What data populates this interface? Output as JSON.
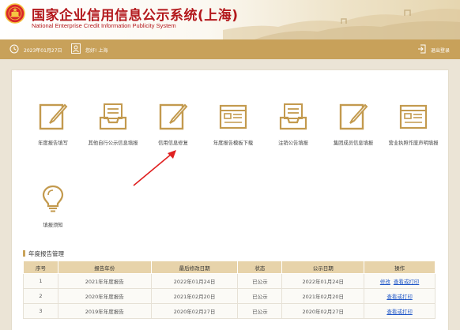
{
  "header": {
    "title": "国家企业信用信息公示系统(上海)",
    "subtitle": "National Enterprise Credit Information Publicity System"
  },
  "infobar": {
    "date": "2023年01月27日",
    "greeting": "您好! 上海",
    "logout": "退出登录"
  },
  "tiles": [
    {
      "label": "年度报告填写",
      "icon": "edit-form-icon"
    },
    {
      "label": "其他自行公示信息填报",
      "icon": "inbox-tray-icon"
    },
    {
      "label": "信用信息修复",
      "icon": "edit-form-icon"
    },
    {
      "label": "年度报告模板下载",
      "icon": "template-list-icon"
    },
    {
      "label": "注销公告填报",
      "icon": "inbox-tray-icon"
    },
    {
      "label": "集团成员信息填报",
      "icon": "edit-form-icon"
    },
    {
      "label": "营业执照作废声明填报",
      "icon": "template-list-icon"
    },
    {
      "label": "填报须知",
      "icon": "lightbulb-icon"
    }
  ],
  "section": {
    "title": "年度报告管理"
  },
  "table": {
    "headers": [
      "序号",
      "报告年份",
      "最后修改日期",
      "状态",
      "公示日期",
      "操作"
    ],
    "rows": [
      {
        "no": "1",
        "year": "2021年年度报告",
        "modified": "2022年01月24日",
        "status": "已公示",
        "published": "2022年01月24日",
        "actions": [
          "修改",
          "查看或打印"
        ]
      },
      {
        "no": "2",
        "year": "2020年年度报告",
        "modified": "2021年02月20日",
        "status": "已公示",
        "published": "2021年02月20日",
        "actions": [
          "查看或打印"
        ]
      },
      {
        "no": "3",
        "year": "2019年年度报告",
        "modified": "2020年02月27日",
        "status": "已公示",
        "published": "2020年02月27日",
        "actions": [
          "查看或打印"
        ]
      }
    ]
  },
  "colors": {
    "brand_red": "#b3181c",
    "gold": "#c8a15a",
    "table_header": "#e7d3aa",
    "link": "#1f56c7",
    "arrow": "#e02020"
  }
}
